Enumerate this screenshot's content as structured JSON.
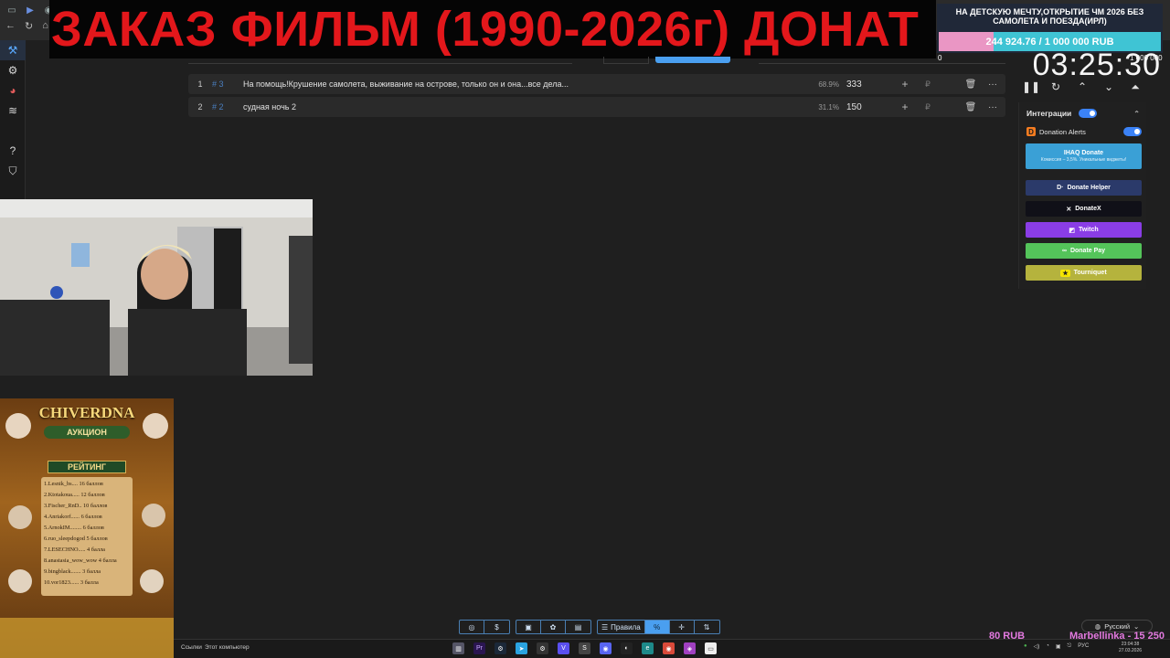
{
  "banner": {
    "text": "ЗАКАЗ ФИЛЬМ (1990-2026г) ДОНАТ"
  },
  "lots": [
    {
      "index": "1",
      "id": "# 3",
      "name": "На помощь!Крушение самолета, выживание на острове, только он и она...все дела...",
      "percent": "68.9%",
      "amount": "333",
      "currency": "₽"
    },
    {
      "index": "2",
      "id": "# 2",
      "name": "судная ночь 2",
      "percent": "31.1%",
      "amount": "150",
      "currency": "₽"
    }
  ],
  "goal": {
    "title": "НА ДЕТСКУЮ МЕЧТУ,ОТКРЫТИЕ ЧМ 2026 БЕЗ САМОЛЕТА И ПОЕЗДА(ИРЛ)",
    "amount": "244 924.76 / 1 000 000 RUB",
    "progress": 0.2449,
    "min": "0",
    "max": "1 000 000"
  },
  "timer": {
    "display": "03:25:30"
  },
  "integrations": {
    "title": "Интеграции",
    "donation_alerts": "Donation Alerts",
    "ihaq": "IHAQ Donate",
    "ihaq_sub": "Комиссия – 3,5%. Уникальные виджеты!",
    "donate_helper": "Donate Helper",
    "donatex": "DonateX",
    "twitch": "Twitch",
    "donate_pay": "Donate Pay",
    "tourniquet": "Tourniquet"
  },
  "auction": {
    "title": "CHIVERDNA",
    "subtitle": "АУКЦИОН",
    "rating_label": "РЕЙТИНГ",
    "ranking": [
      "1.Lesnik_bs.... 16 баллов",
      "2.Ktotakoua..... 12 баллов",
      "3.Fischer_RnD.. 10 баллов",
      "4.Anriakorf...... 6 баллов",
      "5.ArnokIM........ 6 баллов",
      "6.ruo_sleepdogod 5 баллов",
      "7.LESECHNO..... 4 балла",
      "8.anastasia_wow_wow 4 балла",
      "9.bingblack....... 3 балла",
      "10.vor1823...... 3 балла"
    ]
  },
  "toolbar": {
    "rules_label": "Правила",
    "percent_label": "%"
  },
  "language": {
    "value": "Русский"
  },
  "taskbar": {
    "links": "Ссылки",
    "pc": "Этот компьютер",
    "lang": "РУС",
    "time": "23:04:38",
    "date": "27.03.2026"
  },
  "donation_ticker": {
    "amount": "80 RUB",
    "name": "Marbellinka - 15 250"
  },
  "colors": {
    "accent": "#4a9ff0",
    "banner_red": "#e3171b",
    "twitch": "#9146ff",
    "donate_pay": "#54c45a",
    "tourniquet": "#b5b33d",
    "ihaq": "#3aa0d6"
  }
}
